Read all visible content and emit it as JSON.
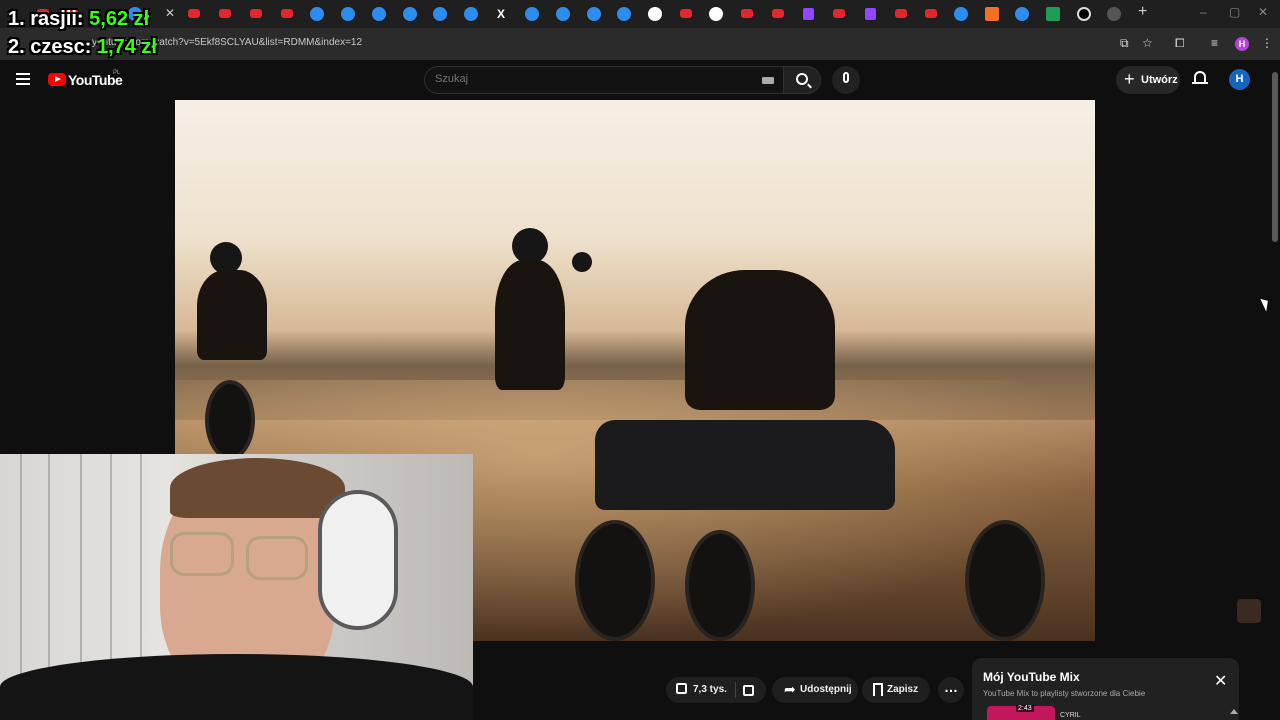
{
  "browser": {
    "tab_favicons": [
      "youtube-icon",
      "youtube-icon",
      "youtube-icon",
      "youtube-icon",
      "messenger-icon",
      "messenger-icon",
      "messenger-icon",
      "messenger-icon",
      "messenger-icon",
      "messenger-icon",
      "x-icon",
      "messenger-icon",
      "messenger-icon",
      "messenger-icon",
      "messenger-icon",
      "google-icon",
      "youtube-icon",
      "google-icon",
      "youtube-icon",
      "youtube-icon",
      "twitch-icon",
      "youtube-icon",
      "twitch-icon",
      "youtube-icon",
      "youtube-icon",
      "messenger-icon",
      "soundcloud-icon",
      "messenger-icon",
      "sheets-icon",
      "github-icon",
      "web-icon"
    ],
    "tab_close": "✕",
    "new_tab": "+",
    "url": "youtube.com/watch?v=5Ekf8SCLYAU&list=RDMM&index=12",
    "profile_initial": "H"
  },
  "stream_overlay": {
    "rows": [
      {
        "label": "1. rasjii:",
        "value": "5,62 zł"
      },
      {
        "label": "2. czesc:",
        "value": "1,74 zł"
      }
    ]
  },
  "youtube": {
    "logo_text": "YouTube",
    "region": "PL",
    "search_placeholder": "Szukaj",
    "create_label": "Utwórz",
    "avatar_initial": "H"
  },
  "actions": {
    "likes": "7,3 tys.",
    "share": "Udostępnij",
    "save": "Zapisz"
  },
  "mix_panel": {
    "title": "Mój YouTube Mix",
    "subtitle": "YouTube Mix to playlisty stworzone dla Ciebie",
    "item_duration": "2:43",
    "item_label": "CYRIL"
  },
  "colors": {
    "overlay_value": "#39ff14",
    "yt_red": "#ff0000",
    "avatar": "#1565c0"
  }
}
